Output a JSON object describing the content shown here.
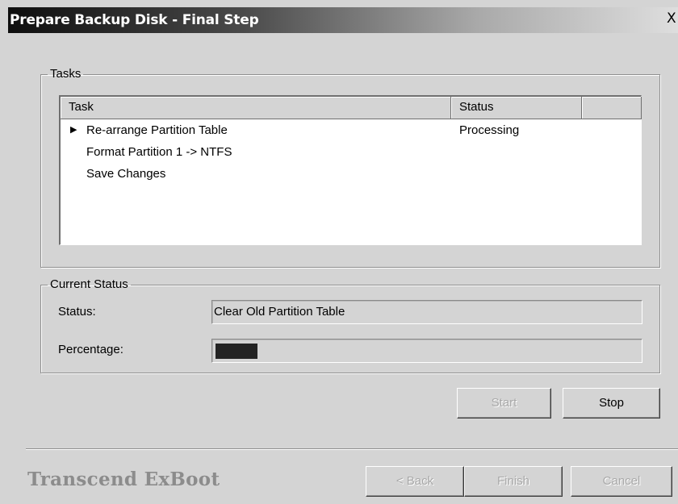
{
  "window": {
    "title": "Prepare Backup Disk - Final Step",
    "close_label": "X"
  },
  "tasks_group": {
    "legend": "Tasks",
    "columns": [
      "Task",
      "Status",
      ""
    ],
    "rows": [
      {
        "task": "Re-arrange Partition Table",
        "status": "Processing",
        "current": true,
        "marker_icon": "play-triangle-icon"
      },
      {
        "task": "Format Partition 1 -> NTFS",
        "status": "",
        "current": false
      },
      {
        "task": "Save Changes",
        "status": "",
        "current": false
      }
    ]
  },
  "current_status_group": {
    "legend": "Current Status",
    "status_label": "Status:",
    "status_value": "Clear Old Partition Table",
    "percentage_label": "Percentage:",
    "percentage_value": 0.1
  },
  "action_buttons": {
    "start": "Start",
    "stop": "Stop"
  },
  "footer": {
    "brand": "Transcend ExBoot",
    "back": "< Back",
    "finish": "Finish",
    "cancel": "Cancel"
  },
  "colors": {
    "face": "#d4d4d4",
    "progress_fill": "#232323",
    "brand_text": "#8c8c8c"
  }
}
